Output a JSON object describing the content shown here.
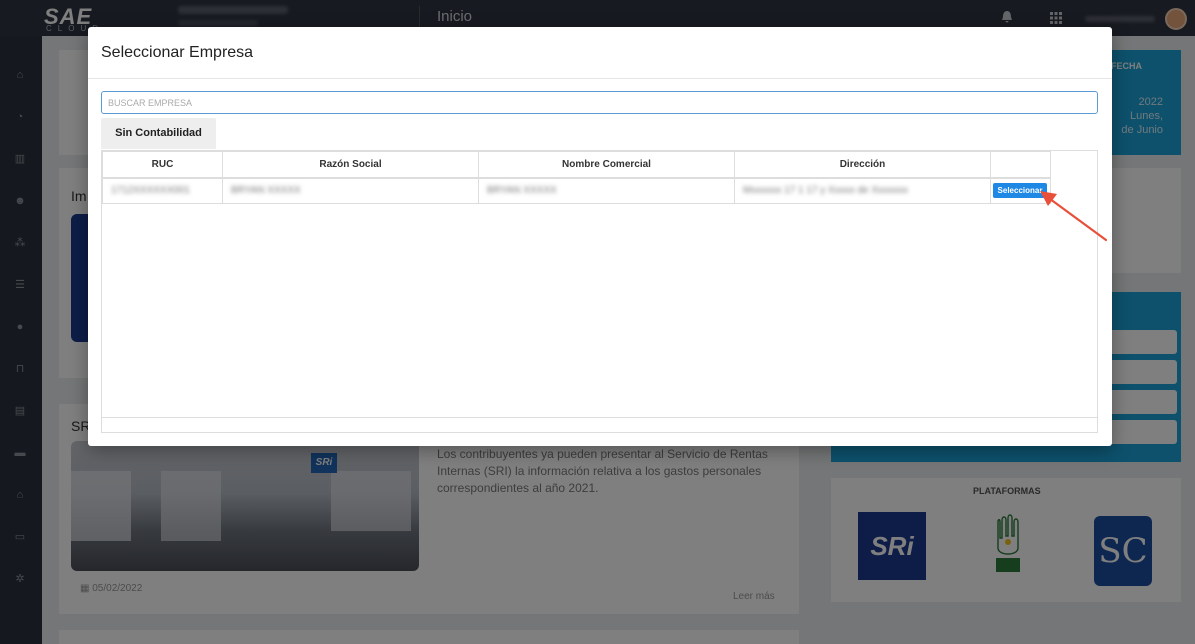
{
  "app": {
    "logo": "SAE",
    "logo_sub": "CLOUD",
    "page_heading": "Inicio"
  },
  "background": {
    "fecha_header": "FECHA",
    "fecha_year": "2022",
    "fecha_day": "Lunes,",
    "fecha_date": "de Junio",
    "section_1_title": "Im",
    "section_2_title": "SR",
    "news_body": "Los contribuyentes ya pueden presentar al Servicio de Rentas Internas (SRI) la información relativa a los gastos personales correspondientes al año 2021.",
    "news_date": "05/02/2022",
    "read_more": "Leer más",
    "platforms_title": "PLATAFORMAS",
    "sri_logo_text": "SRi",
    "sc_logo_text": "SC"
  },
  "modal": {
    "title": "Seleccionar Empresa",
    "search_placeholder": "BUSCAR EMPRESA",
    "tab_label": "Sin Contabilidad",
    "columns": [
      "RUC",
      "Razón Social",
      "Nombre Comercial",
      "Dirección",
      ""
    ],
    "rows": [
      {
        "ruc": "1712XXXXXX001",
        "razon_social": "BRYAN XXXXX",
        "nombre_comercial": "BRYAN XXXXX",
        "direccion": "Mxxxxxx 17 1 17 y Xxxxx de Xxxxxxx",
        "action": "Seleccionar"
      }
    ]
  },
  "colors": {
    "topbar": "#2f3541",
    "accent": "#1e88e5",
    "arrow": "#e8503a"
  }
}
